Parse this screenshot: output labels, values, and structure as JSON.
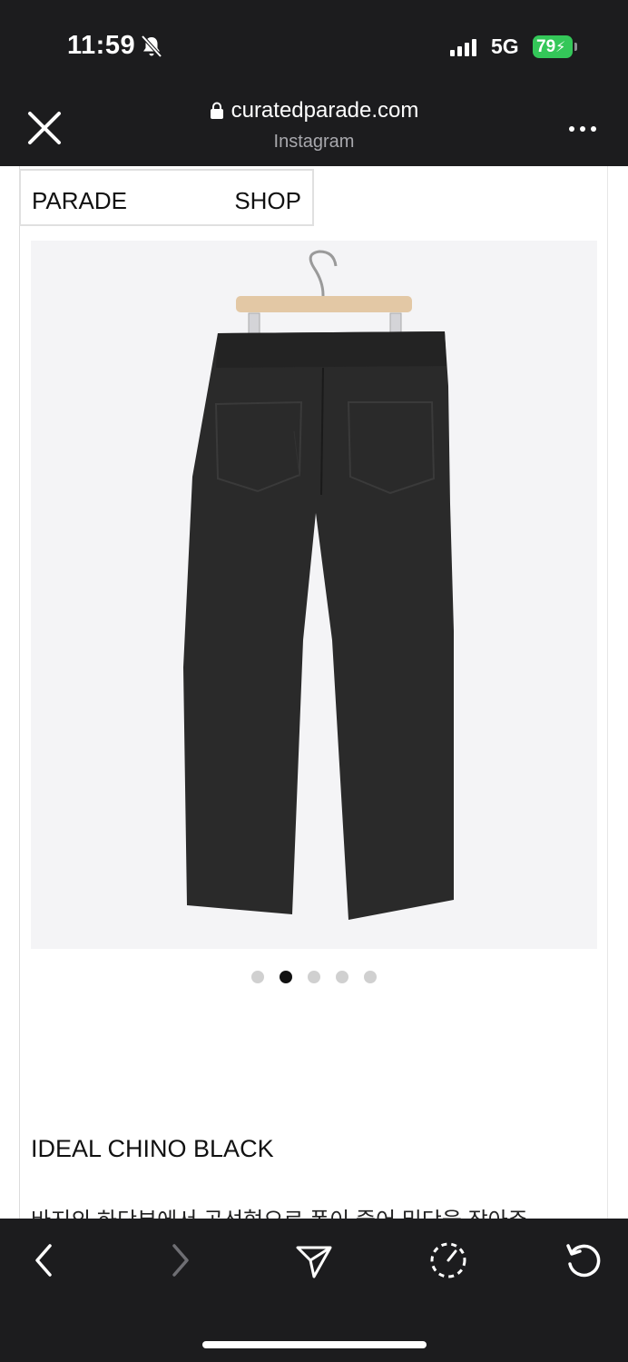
{
  "status": {
    "time": "11:59",
    "network": "5G",
    "battery": "79"
  },
  "icons": {
    "silent": "bell-slash-icon",
    "signal": "cellular-signal-icon",
    "charging": "bolt-icon",
    "lock": "lock-icon",
    "close": "close-icon",
    "more": "ellipsis-icon",
    "back": "chevron-left-icon",
    "forward": "chevron-right-icon",
    "share": "send-icon",
    "timer": "timer-icon",
    "reload": "reload-icon"
  },
  "browser": {
    "url": "curatedparade.com",
    "subtitle": "Instagram"
  },
  "site": {
    "nav": {
      "brand": "PARADE",
      "shop": "SHOP"
    }
  },
  "product": {
    "image_alt": "black chino trousers on wooden hanger, back view",
    "carousel": {
      "count": 5,
      "active_index": 2
    },
    "title": "IDEAL CHINO BLACK",
    "description_partial": "바지의 하단부에서 곡선형으로 폼이 줄어 밑단을 잡아주"
  },
  "colors": {
    "chrome": "#1c1c1e",
    "battery": "#34c759",
    "page": "#ffffff",
    "garment": "#2a2a2a"
  }
}
